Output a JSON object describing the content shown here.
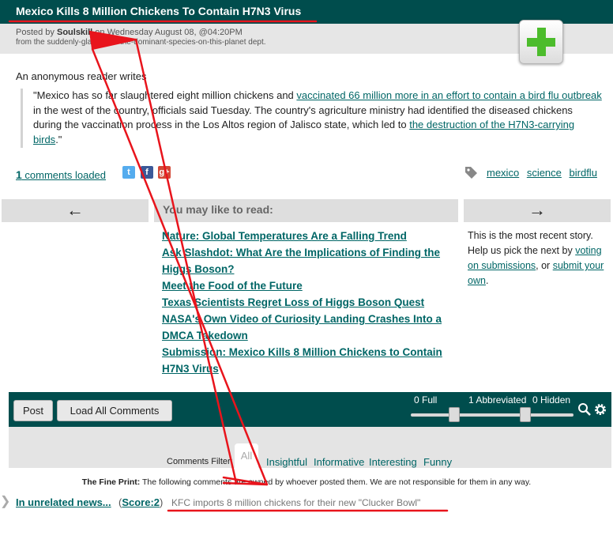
{
  "story": {
    "title": "Mexico Kills 8 Million Chickens To Contain H7N3 Virus",
    "posted_by_prefix": "Posted by ",
    "author": "Soulskill",
    "posted_on": " on Wednesday August 08, @04:20PM",
    "dept": "from the suddenly-glad-we're-the-dominant-species-on-this-planet dept.",
    "intro": "An anonymous reader writes",
    "quote_1": "\"Mexico has so far slaughtered eight million chickens and ",
    "link_1": "vaccinated 66 million more in an effort to contain a bird flu outbreak",
    "quote_2": " in the west of the country, officials said Tuesday. The country's agriculture ministry had identified the diseased chickens during the vaccination process in the Los Altos region of Jalisco state, which led to ",
    "link_2": "the destruction of the H7N3-carrying birds",
    "quote_3": ".\""
  },
  "comments_loaded": {
    "count": "1",
    "label": " comments loaded"
  },
  "share": [
    {
      "name": "twitter-icon",
      "glyph": "t",
      "color": "#55acee"
    },
    {
      "name": "facebook-icon",
      "glyph": "f",
      "color": "#3b5998"
    },
    {
      "name": "googleplus-icon",
      "glyph": "g+",
      "color": "#d34836"
    }
  ],
  "tags": [
    "mexico",
    "science",
    "birdflu"
  ],
  "nav": {
    "prev_arrow": "←",
    "next_arrow": "→",
    "read_heading": "You may like to read:",
    "read_items": [
      "Nature: Global Temperatures Are a Falling Trend",
      "Ask Slashdot: What Are the Implications of Finding the Higgs Boson?",
      "Meet the Food of the Future",
      "Texas Scientists Regret Loss of Higgs Boson Quest",
      "NASA's Own Video of Curiosity Landing Crashes Into a DMCA Takedown",
      "Submission: Mexico Kills 8 Million Chickens to Contain H7N3 Virus"
    ],
    "recent_text_1": "This is the most recent story. Help us pick the next by ",
    "recent_link_1": "voting on submissions",
    "recent_text_2": ", or ",
    "recent_link_2": "submit your own",
    "recent_text_3": "."
  },
  "toolbar": {
    "post_label": "Post",
    "load_all_label": "Load All Comments",
    "full_label": "0 Full",
    "abbrev_label": "1 Abbreviated",
    "hidden_label": "0 Hidden"
  },
  "filter": {
    "label": "Comments Filter:",
    "all": "All",
    "options": [
      "Insightful",
      "Informative",
      "Interesting",
      "Funny"
    ]
  },
  "fine_print": {
    "bold": "The Fine Print:",
    "text": " The following comments are owned by whoever posted them. We are not responsible for them in any way."
  },
  "comment": {
    "title": "In unrelated news...",
    "score_open": "(",
    "score": "Score:2",
    "score_close": ")",
    "subject": "KFC imports 8 million chickens for their new \"Clucker Bowl\""
  },
  "colors": {
    "header_bg": "#004d4d",
    "link": "#006666",
    "annotation_red": "#e8141c",
    "plus_green": "#4cbc2c"
  }
}
